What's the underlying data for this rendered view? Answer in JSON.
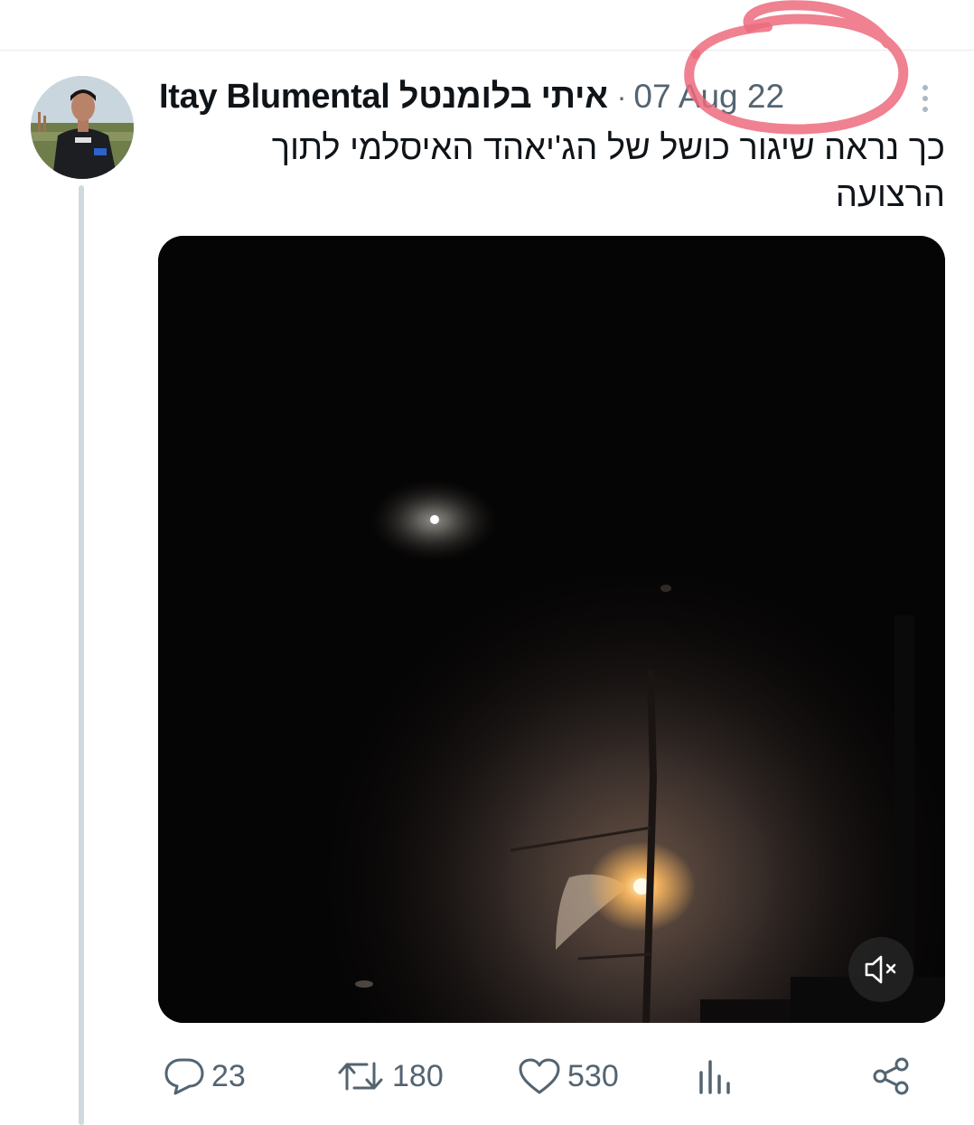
{
  "tweet": {
    "author": {
      "display_name": "Itay Blumental איתי בלומנטל"
    },
    "separator": "·",
    "timestamp": "07 Aug 22",
    "text": "כך נראה שיגור כושל של הג'יאהד האיסלמי לתוך הרצועה",
    "media": {
      "type": "video",
      "muted": true
    },
    "actions": {
      "replies": "23",
      "retweets": "180",
      "likes": "530"
    }
  },
  "icons": {
    "more": "more-vertical-icon",
    "mute": "volume-muted-icon",
    "reply": "comment-bubble-icon",
    "retweet": "retweet-arrows-icon",
    "like": "heart-icon",
    "views": "bar-chart-icon",
    "share": "share-icon"
  },
  "colors": {
    "text_primary": "#0f1419",
    "text_secondary": "#536471",
    "thread_line": "#cfd9de",
    "annotation": "#ec6b7e"
  }
}
